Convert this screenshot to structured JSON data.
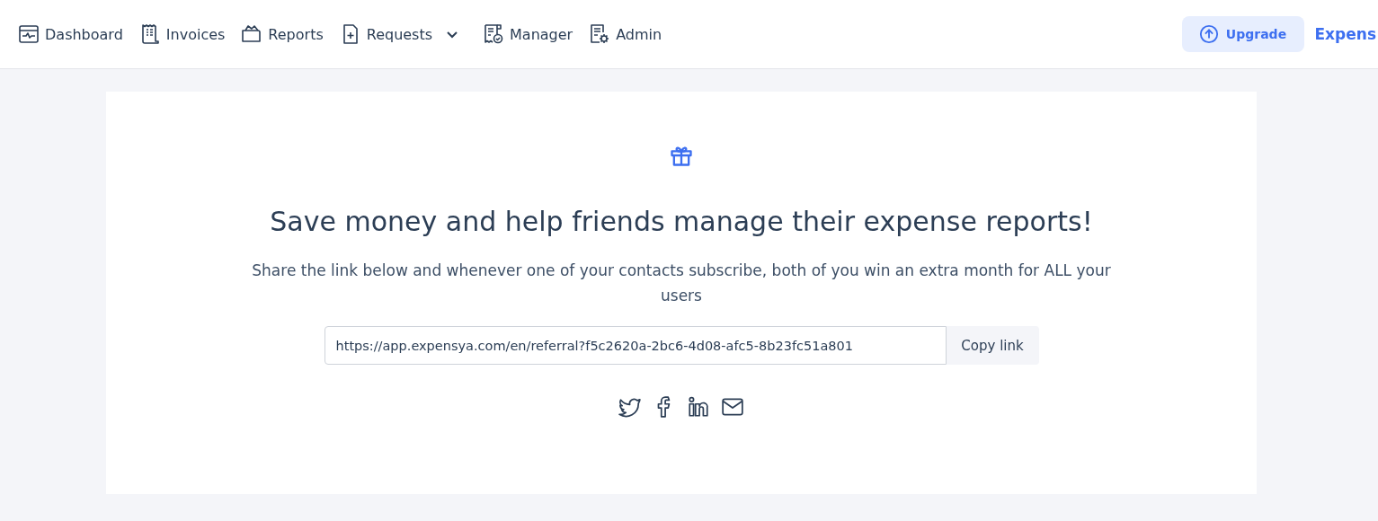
{
  "nav": {
    "items": [
      {
        "label": "Dashboard",
        "has_menu": false
      },
      {
        "label": "Invoices",
        "has_menu": false
      },
      {
        "label": "Reports",
        "has_menu": false
      },
      {
        "label": "Requests",
        "has_menu": true
      },
      {
        "label": "Manager",
        "has_menu": false
      },
      {
        "label": "Admin",
        "has_menu": false
      }
    ],
    "upgrade_button": "Upgrade",
    "brand": "Expens"
  },
  "referral": {
    "title": "Save money and help friends manage their expense reports!",
    "description": "Share the link below and whenever one of your contacts subscribe, both of you win an extra month for ALL your users",
    "link": "https://app.expensya.com/en/referral?f5c2620a-2bc6-4d08-afc5-8b23fc51a801",
    "copy_button": "Copy link"
  }
}
